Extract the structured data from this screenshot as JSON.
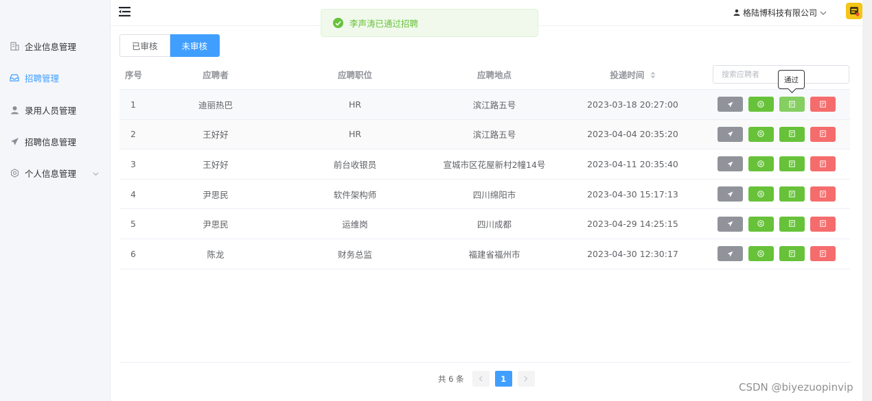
{
  "sidebar": {
    "items": [
      {
        "label": "企业信息管理",
        "icon": "building-icon"
      },
      {
        "label": "招聘管理",
        "icon": "inbox-icon",
        "active": true
      },
      {
        "label": "录用人员管理",
        "icon": "user-icon"
      },
      {
        "label": "招聘信息管理",
        "icon": "send-icon"
      },
      {
        "label": "个人信息管理",
        "icon": "gear-icon",
        "has_submenu": true
      }
    ]
  },
  "header": {
    "company": "格陆博科技有限公司"
  },
  "toast": {
    "message": "李声涛已通过招聘",
    "color": "#67c23a"
  },
  "tabs": [
    {
      "label": "已审核"
    },
    {
      "label": "未审核",
      "active": true
    }
  ],
  "table": {
    "headers": {
      "no": "序号",
      "name": "应聘者",
      "position": "应聘职位",
      "location": "应聘地点",
      "time": "投递时间"
    },
    "search_placeholder": "搜索应聘者",
    "rows": [
      {
        "no": "1",
        "name": "迪丽热巴",
        "position": "HR",
        "location": "滨江路五号",
        "time": "2023-03-18 20:27:00"
      },
      {
        "no": "2",
        "name": "王好好",
        "position": "HR",
        "location": "滨江路五号",
        "time": "2023-04-04 20:35:20"
      },
      {
        "no": "3",
        "name": "王好好",
        "position": "前台收银员",
        "location": "宣城市区花屋新村2幢14号",
        "time": "2023-04-11 20:35:40"
      },
      {
        "no": "4",
        "name": "尹思民",
        "position": "软件架构师",
        "location": "四川绵阳市",
        "time": "2023-04-30 15:17:13"
      },
      {
        "no": "5",
        "name": "尹思民",
        "position": "运维岗",
        "location": "四川成都",
        "time": "2023-04-29 14:25:15"
      },
      {
        "no": "6",
        "name": "陈龙",
        "position": "财务总监",
        "location": "福建省福州市",
        "time": "2023-04-30 12:30:17"
      }
    ],
    "tooltip": "通过"
  },
  "pagination": {
    "total": "共 6 条",
    "current": "1"
  },
  "watermark": "CSDN @biyezuopinvip",
  "colors": {
    "primary": "#409eff",
    "success": "#67c23a",
    "danger": "#f56c6c",
    "info": "#909399"
  }
}
